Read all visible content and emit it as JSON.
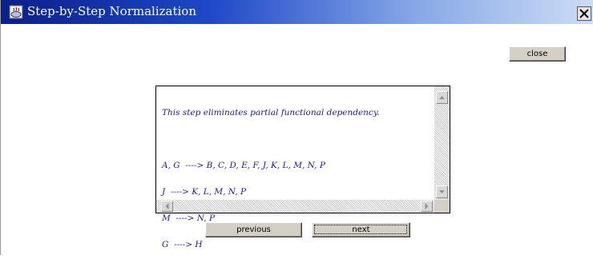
{
  "window": {
    "title": "Step-by-Step Normalization"
  },
  "icons": {
    "app": "app-icon",
    "window_close": "close-icon",
    "scroll_up": "chevron-up-icon",
    "scroll_down": "chevron-down-icon",
    "scroll_left": "chevron-left-icon",
    "scroll_right": "chevron-right-icon"
  },
  "toolbar": {
    "close_label": "close"
  },
  "textarea": {
    "intro": "This step eliminates partial functional dependency.",
    "dependencies": [
      "A, G  ----> B, C, D, E, F, J, K, L, M, N, P",
      "J  ----> K, L, M, N, P",
      "M  ----> N, P",
      "G  ----> H"
    ]
  },
  "navigation": {
    "previous_label": "previous",
    "next_label": "next"
  },
  "colors": {
    "title_bar_start": "#0a1f8a",
    "title_bar_end": "#cddcf6",
    "text": "#1a1a8c",
    "button_face": "#d4d0c8"
  }
}
